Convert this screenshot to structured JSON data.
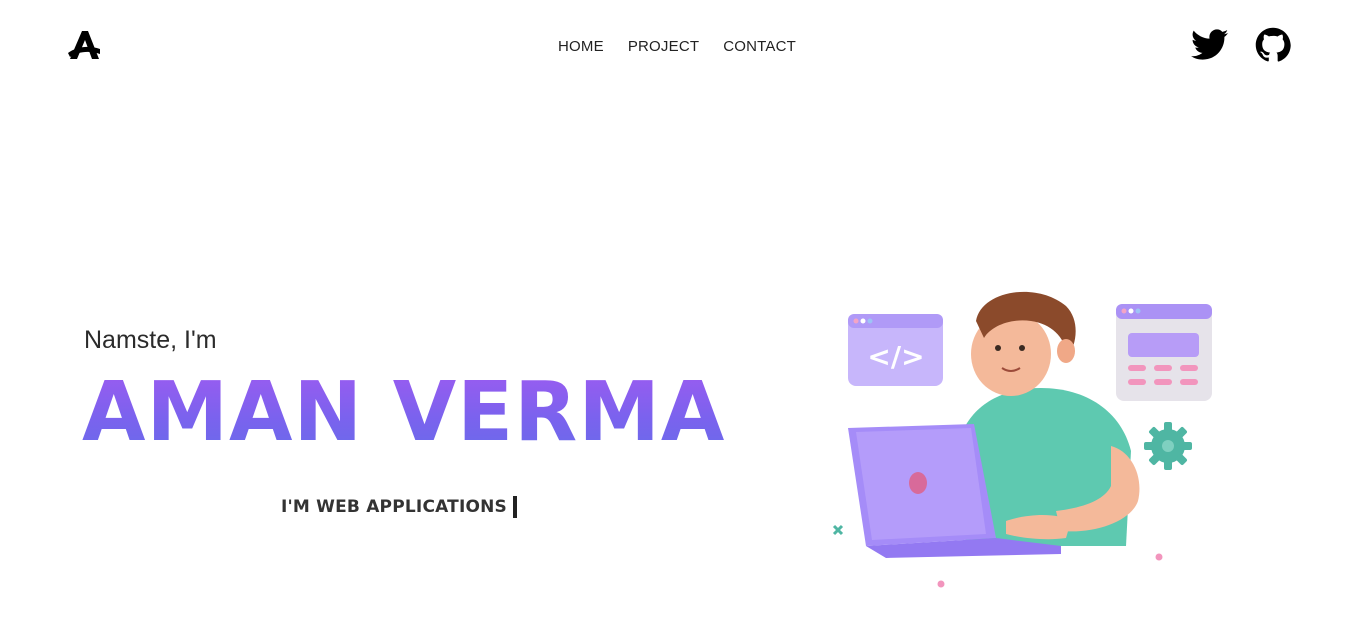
{
  "header": {
    "logo_icon": "a-logo-icon",
    "nav": [
      {
        "label": "HOME"
      },
      {
        "label": "PROJECT"
      },
      {
        "label": "CONTACT"
      }
    ],
    "social": [
      {
        "icon": "twitter-icon"
      },
      {
        "icon": "github-icon"
      }
    ]
  },
  "hero": {
    "greeting": "Namste, I'm",
    "name": "AMAN VERMA",
    "tagline": "I'M WEB APPLICATIONS"
  },
  "colors": {
    "accent_start": "#9a5cf0",
    "accent_end": "#6a6bea",
    "text": "#222222"
  }
}
